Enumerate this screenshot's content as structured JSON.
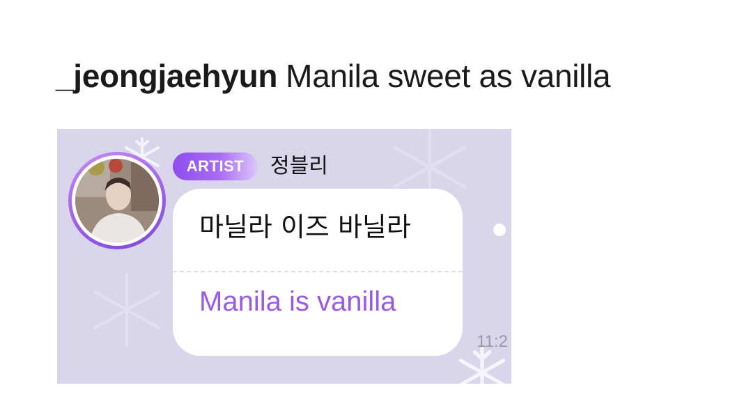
{
  "post": {
    "username": "_jeongjaehyun",
    "caption": "Manila sweet as vanilla"
  },
  "chat": {
    "badge": "ARTIST",
    "display_name": "정블리",
    "message_original": "마닐라 이즈 바닐라",
    "message_translation": "Manila is vanilla",
    "timestamp": "11:2",
    "avatar": "artist-profile-photo",
    "colors": {
      "background": "#d9d6ec",
      "badge": "#8e4df1",
      "translation_text": "#9a5ae6",
      "avatar_ring": "#9a5ce8"
    },
    "decoration": "snowflake-icon"
  }
}
